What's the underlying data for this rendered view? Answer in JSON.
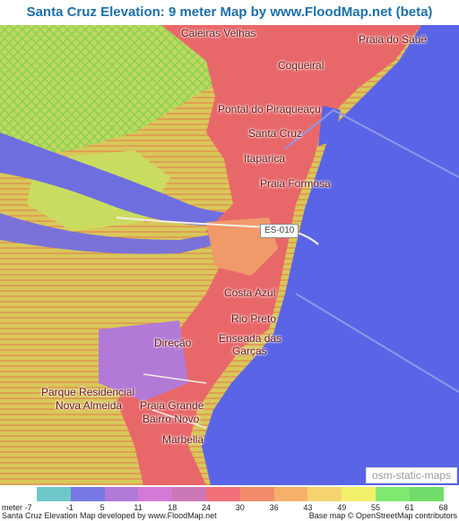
{
  "title": "Santa Cruz Elevation: 9 meter Map by www.FloodMap.net (beta)",
  "map": {
    "places": [
      {
        "id": "caieiras-velhas",
        "name": "Caieiras Velhas"
      },
      {
        "id": "praia-do-sauê",
        "name": "Praia do Sauê"
      },
      {
        "id": "coqueiral",
        "name": "Coqueiral"
      },
      {
        "id": "pontal",
        "name": "Pontal do Piraqueaçu"
      },
      {
        "id": "santa-cruz",
        "name": "Santa Cruz"
      },
      {
        "id": "itaparica",
        "name": "Itaparica"
      },
      {
        "id": "praia-formosa",
        "name": "Praia Formosa"
      },
      {
        "id": "costa-azul",
        "name": "Costa Azul"
      },
      {
        "id": "rio-preto",
        "name": "Rio Preto"
      },
      {
        "id": "enseada-1",
        "name": "Enseada das"
      },
      {
        "id": "enseada-2",
        "name": "Garças"
      },
      {
        "id": "direcao",
        "name": "Direção"
      },
      {
        "id": "parque-1",
        "name": "Parque Residencial"
      },
      {
        "id": "parque-2",
        "name": "Nova Almeida"
      },
      {
        "id": "praia-grande",
        "name": "Praia Grande"
      },
      {
        "id": "bairro-novo",
        "name": "Bairro Novo"
      },
      {
        "id": "marbella",
        "name": "Marbella"
      }
    ],
    "road_shield": "ES-010",
    "credit": "osm-static-maps",
    "colors": {
      "sea": "#5a64e6",
      "lowland": "#e8686a",
      "mid": "#f2a26a",
      "high": "#e6d766",
      "hill": "#a9d86a"
    }
  },
  "legend": {
    "unit_label": "meter",
    "colors": [
      "#6fc8c8",
      "#7878e6",
      "#b07ad8",
      "#d47ad6",
      "#cc78b8",
      "#f2707a",
      "#f28c6a",
      "#f5b06a",
      "#f5d470",
      "#f2f06a",
      "#7ee870",
      "#72dc6a"
    ],
    "ticks": [
      "-7",
      "-1",
      "5",
      "11",
      "18",
      "24",
      "30",
      "36",
      "43",
      "49",
      "55",
      "61",
      "68"
    ],
    "footer_left": "Santa Cruz Elevation Map developed by www.FloodMap.net",
    "footer_right": "Base map © OpenStreetMap contributors"
  }
}
